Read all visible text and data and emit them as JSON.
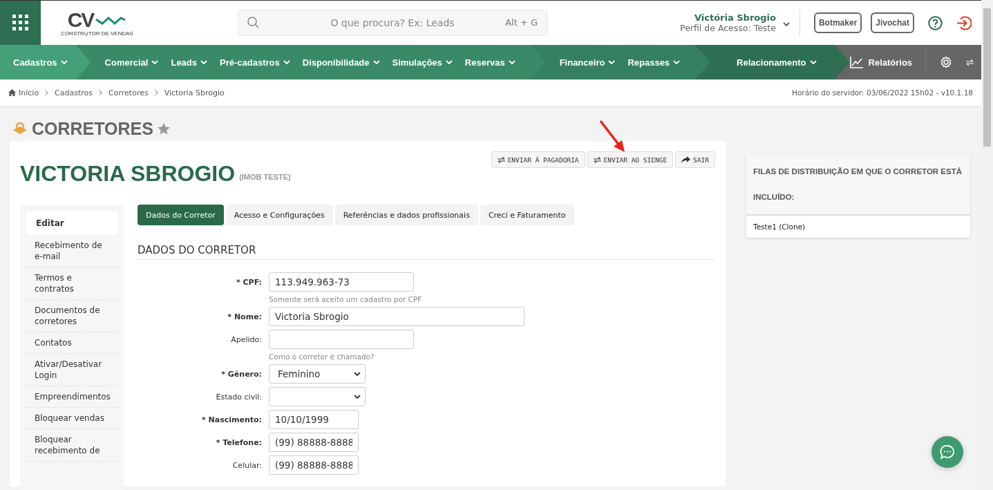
{
  "header": {
    "logo": {
      "letters": "CV",
      "tagline": "CONSTRUTOR DE VENDAS"
    },
    "search": {
      "placeholder": "O que procura? Ex: Leads",
      "shortcut": "Alt + G"
    },
    "user": {
      "name": "Victória Sbrogio",
      "profile": "Perfil de Acesso: Teste"
    },
    "buttons": [
      "Botmaker",
      "Jivochat"
    ]
  },
  "nav": {
    "groups": [
      {
        "items": [
          "Cadastros"
        ]
      },
      {
        "items": [
          "Comercial",
          "Leads",
          "Pré-cadastros",
          "Disponibilidade",
          "Simulações",
          "Reservas"
        ]
      },
      {
        "items": [
          "Financeiro",
          "Repasses"
        ]
      },
      {
        "items": [
          "Relacionamento"
        ]
      }
    ],
    "reports": "Relatórios"
  },
  "breadcrumb": [
    "Início",
    "Cadastros",
    "Corretores",
    "Victoria Sbrogio"
  ],
  "server_time": "Horário do servidor: 03/06/2022 15h02 - v10.1.18",
  "page_title": "CORRETORES",
  "record": {
    "name": "VICTORIA SBROGIO",
    "company": "(IMOB TESTE)",
    "actions": [
      {
        "label": "ENVIAR À PAGADORIA",
        "kind": "send"
      },
      {
        "label": "ENVIAR AO SIENGE",
        "kind": "send"
      },
      {
        "label": "SAIR",
        "kind": "exit"
      }
    ]
  },
  "sidebar": {
    "items": [
      {
        "label": "Editar",
        "selected": true
      },
      {
        "label": "Recebimento de e-mail",
        "selected": false
      },
      {
        "label": "Termos e contratos",
        "selected": false
      },
      {
        "label": "Documentos de corretores",
        "selected": false
      },
      {
        "label": "Contatos",
        "selected": false
      },
      {
        "label": "Ativar/Desativar Login",
        "selected": false
      },
      {
        "label": "Empreendimentos",
        "selected": false
      },
      {
        "label": "Bloquear vendas",
        "selected": false
      },
      {
        "label": "Bloquear recebimento de",
        "selected": false
      }
    ]
  },
  "tabs": [
    {
      "label": "Dados do Corretor",
      "selected": true
    },
    {
      "label": "Acesso e Configurações",
      "selected": false
    },
    {
      "label": "Referências e dados profissionais",
      "selected": false
    },
    {
      "label": "Creci e Faturamento",
      "selected": false
    }
  ],
  "section_title": "DADOS DO CORRETOR",
  "fields": [
    {
      "label": "* CPF:",
      "required": true,
      "kind": "text",
      "value": "113.949.963-73",
      "help": "Somente será aceito um cadastro por CPF"
    },
    {
      "label": "* Nome:",
      "required": true,
      "kind": "text",
      "value": "Victoria Sbrogio"
    },
    {
      "label": "Apelido:",
      "required": false,
      "kind": "text",
      "help": "Como o corretor é chamado?"
    },
    {
      "label": "* Gênero:",
      "required": true,
      "kind": "select",
      "value": "Feminino"
    },
    {
      "label": "Estado civil:",
      "required": false,
      "kind": "select"
    },
    {
      "label": "* Nascimento:",
      "required": true,
      "kind": "text",
      "value": "10/10/1999"
    },
    {
      "label": "* Telefone:",
      "required": true,
      "kind": "text",
      "value": "(99) 88888-8888"
    },
    {
      "label": "Celular:",
      "required": false,
      "kind": "text",
      "value": "(99) 88888-8888"
    }
  ],
  "side_panel": {
    "title": "FILAS DE DISTRIBUIÇÃO EM QUE O CORRETOR ESTÁ INCLUÍDO:",
    "items": [
      "Teste1 (Clone)"
    ]
  }
}
